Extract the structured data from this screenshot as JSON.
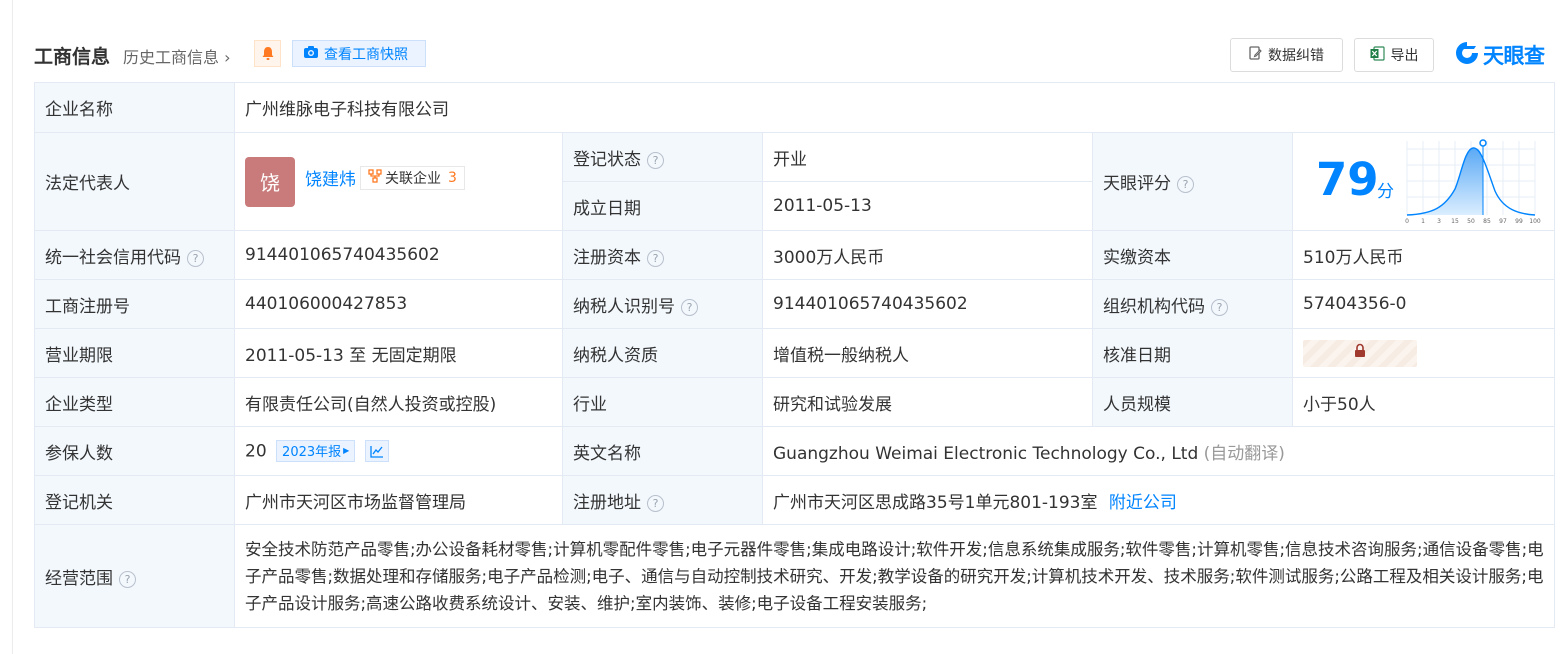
{
  "header": {
    "title": "工商信息",
    "history_link": "历史工商信息",
    "snapshot_label": "查看工商快照",
    "correct_label": "数据纠错",
    "export_label": "导出",
    "logo_text": "天眼查",
    "accent_color": "#0084ff"
  },
  "rows": {
    "company_name": {
      "label": "企业名称",
      "value": "广州维脉电子科技有限公司"
    },
    "legal_rep": {
      "label": "法定代表人",
      "avatar_char": "饶",
      "name": "饶建炜",
      "related_label": "关联企业",
      "related_count": "3"
    },
    "reg_status": {
      "label": "登记状态",
      "value": "开业"
    },
    "est_date": {
      "label": "成立日期",
      "value": "2011-05-13"
    },
    "score": {
      "label": "天眼评分",
      "value": "79",
      "unit": "分",
      "axis_ticks": [
        "0",
        "1",
        "3",
        "15",
        "50",
        "85",
        "97",
        "99",
        "100"
      ]
    },
    "credit_code": {
      "label": "统一社会信用代码",
      "value": "914401065740435602"
    },
    "reg_capital": {
      "label": "注册资本",
      "value": "3000万人民币"
    },
    "paid_capital": {
      "label": "实缴资本",
      "value": "510万人民币"
    },
    "reg_no": {
      "label": "工商注册号",
      "value": "440106000427853"
    },
    "taxpayer_id": {
      "label": "纳税人识别号",
      "value": "914401065740435602"
    },
    "org_code": {
      "label": "组织机构代码",
      "value": "57404356-0"
    },
    "term": {
      "label": "营业期限",
      "value": "2011-05-13 至 无固定期限"
    },
    "taxpayer_qual": {
      "label": "纳税人资质",
      "value": "增值税一般纳税人"
    },
    "approve_date": {
      "label": "核准日期"
    },
    "company_type": {
      "label": "企业类型",
      "value": "有限责任公司(自然人投资或控股)"
    },
    "industry": {
      "label": "行业",
      "value": "研究和试验发展"
    },
    "staff_size": {
      "label": "人员规模",
      "value": "小于50人"
    },
    "insured": {
      "label": "参保人数",
      "value": "20",
      "report_tag": "2023年报"
    },
    "english_name": {
      "label": "英文名称",
      "value": "Guangzhou Weimai Electronic Technology Co., Ltd",
      "note": "(自动翻译)"
    },
    "authority": {
      "label": "登记机关",
      "value": "广州市天河区市场监督管理局"
    },
    "address": {
      "label": "注册地址",
      "value": "广州市天河区思成路35号1单元801-193室",
      "nearby": "附近公司"
    },
    "scope": {
      "label": "经营范围",
      "value": "安全技术防范产品零售;办公设备耗材零售;计算机零配件零售;电子元器件零售;集成电路设计;软件开发;信息系统集成服务;软件零售;计算机零售;信息技术咨询服务;通信设备零售;电子产品零售;数据处理和存储服务;电子产品检测;电子、通信与自动控制技术研究、开发;教学设备的研究开发;计算机技术开发、技术服务;软件测试服务;公路工程及相关设计服务;电子产品设计服务;高速公路收费系统设计、安装、维护;室内装饰、装修;电子设备工程安装服务;"
    }
  }
}
